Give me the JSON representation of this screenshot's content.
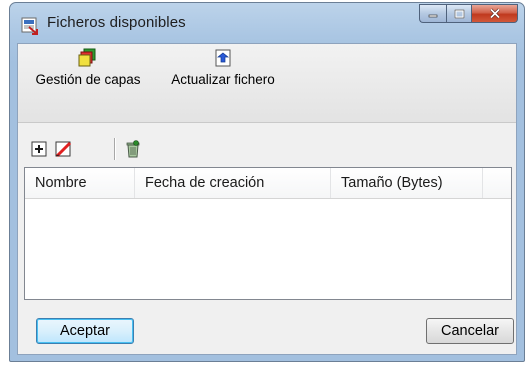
{
  "window": {
    "title": "Ficheros disponibles"
  },
  "ribbon": {
    "buttons": [
      {
        "label": "Gestión de capas",
        "icon": "layers-icon"
      },
      {
        "label": "Actualizar fichero",
        "icon": "refresh-file-icon"
      }
    ]
  },
  "toolbar": {
    "buttons": [
      {
        "icon": "add-icon"
      },
      {
        "icon": "edit-icon"
      },
      {
        "icon": "delete-icon"
      }
    ]
  },
  "table": {
    "columns": [
      "Nombre",
      "Fecha de creación",
      "Tamaño (Bytes)"
    ],
    "rows": []
  },
  "footer": {
    "ok_label": "Aceptar",
    "cancel_label": "Cancelar"
  },
  "colors": {
    "accent": "#3c7fb1",
    "close": "#c0391e",
    "titlebar": "#aac6e3"
  }
}
